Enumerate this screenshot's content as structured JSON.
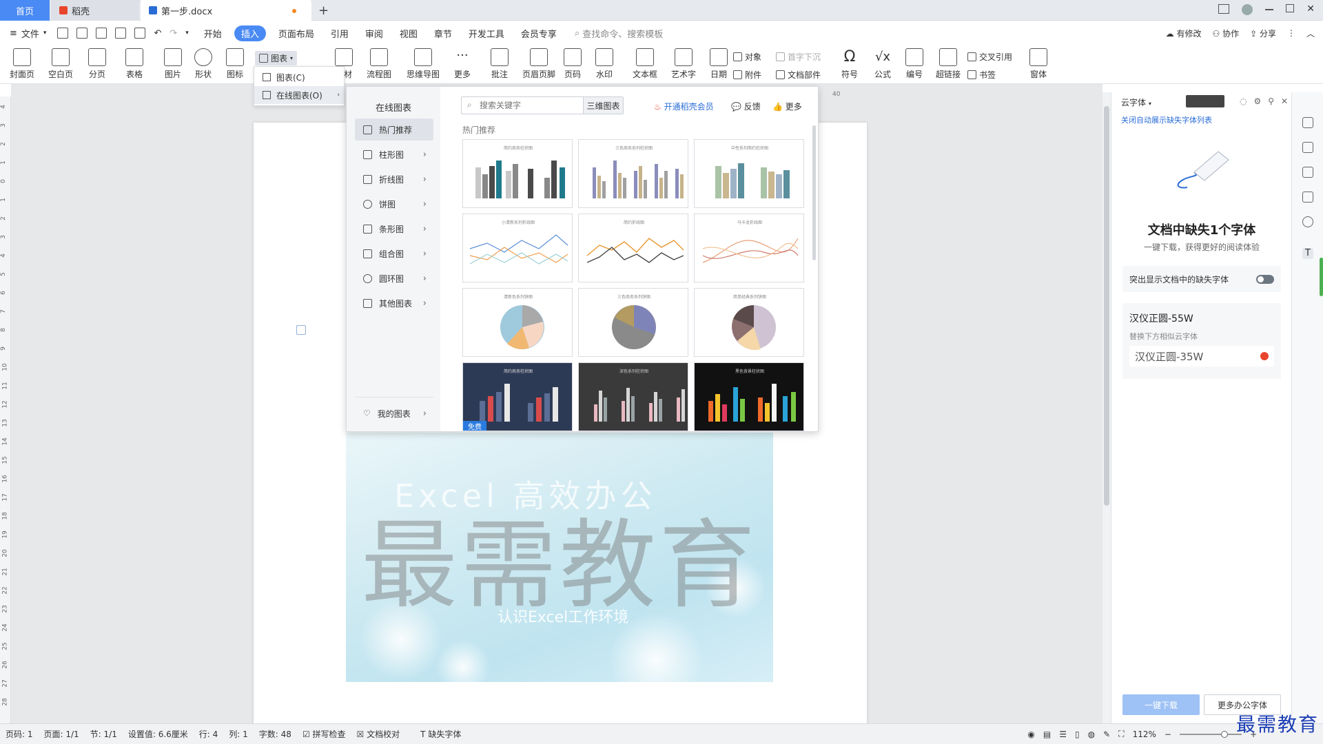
{
  "tabs": {
    "home": "首页",
    "daoke": "稻壳",
    "doc": "第一步.docx"
  },
  "menubar": {
    "file": "文件",
    "items": [
      "开始",
      "插入",
      "页面布局",
      "引用",
      "审阅",
      "视图",
      "章节",
      "开发工具",
      "会员专享"
    ],
    "active_index": 1,
    "search_placeholder": "查找命令、搜索模板",
    "right": [
      "有修改",
      "协作",
      "分享"
    ]
  },
  "ribbon": {
    "buttons": [
      "封面页",
      "空白页",
      "分页",
      "表格",
      "图片",
      "形状",
      "图标",
      "图表",
      "素材",
      "流程图",
      "思维导图",
      "更多",
      "批注",
      "页眉页脚",
      "页码",
      "水印",
      "文本框",
      "艺术字",
      "日期",
      "对象",
      "附件",
      "首字下沉",
      "文档部件",
      "符号",
      "公式",
      "编号",
      "超链接",
      "交叉引用",
      "书签",
      "窗体"
    ]
  },
  "chart_menu": {
    "items": [
      "图表(C)",
      "在线图表(O)"
    ]
  },
  "online_panel": {
    "title": "在线图表",
    "categories": [
      "热门推荐",
      "柱形图",
      "折线图",
      "饼图",
      "条形图",
      "组合图",
      "圆环图",
      "其他图表"
    ],
    "my_charts": "我的图表",
    "search_placeholder": "搜索关键字",
    "three_d": "三维图表",
    "vip": "开通稻壳会员",
    "feedback": "反馈",
    "more": "更多",
    "hot_label": "热门推荐",
    "free_badge": "免费",
    "thumb_titles": [
      "简约商务柱状图",
      "三色商务系列柱状图",
      "中性系列简约柱状图",
      "小清新系列折线图",
      "简约折线图",
      "马卡龙折线图",
      "清新色系列饼图",
      "三色商务系列饼图",
      "简单经典系列饼图",
      "简约商务柱状图",
      "深色系列柱状图",
      "黑色背景柱状图"
    ]
  },
  "cover": {
    "top_text": "Excel 高效办公",
    "big_text": "最需教育",
    "sub_text": "认识Excel工作环境"
  },
  "font_panel": {
    "header": "云字体",
    "close_auto": "关闭自动展示缺失字体列表",
    "heading": "文档中缺失1个字体",
    "subheading": "一键下载，获得更好的阅读体验",
    "toggle_label": "突出显示文档中的缺失字体",
    "missing_font": "汉仪正圆-55W",
    "replace_hint": "替换下方相似云字体",
    "replacement_font": "汉仪正圆-35W",
    "download_btn": "一键下载",
    "more_fonts_btn": "更多办公字体"
  },
  "statusbar": {
    "items": [
      "页码: 1",
      "页面: 1/1",
      "节: 1/1",
      "设置值: 6.6厘米",
      "行: 4",
      "列: 1",
      "字数: 48",
      "拼写检查",
      "文档校对",
      "缺失字体"
    ],
    "zoom": "112%"
  },
  "ruler_top_label": "40",
  "watermark": "最需教育",
  "colors": {
    "accent": "#4a8af4",
    "vip_red": "#e8452d",
    "link_blue": "#2a6cd6"
  }
}
